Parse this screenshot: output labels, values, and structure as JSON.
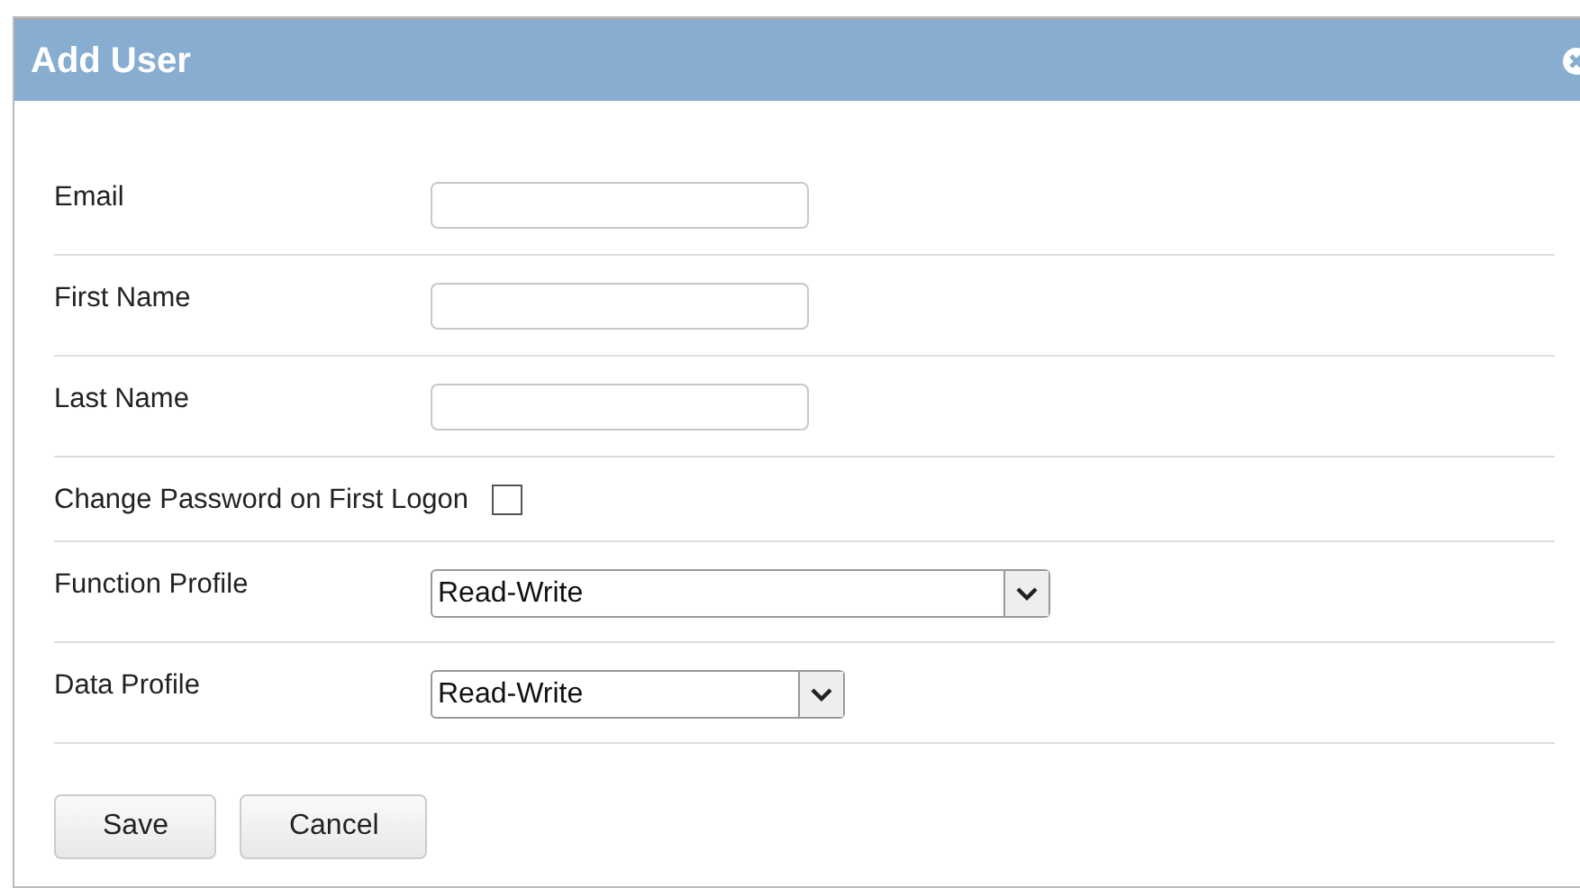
{
  "dialog": {
    "title": "Add User"
  },
  "fields": [
    {
      "kind": "text",
      "label": "Email"
    },
    {
      "kind": "text",
      "label": "First Name"
    },
    {
      "kind": "text",
      "label": "Last Name"
    },
    {
      "kind": "checkbox",
      "label": "Change Password on First Logon",
      "checked": false
    },
    {
      "kind": "select",
      "label": "Function Profile",
      "value": "Read-Write",
      "wide": true
    },
    {
      "kind": "select",
      "label": "Data Profile",
      "value": "Read-Write",
      "wide": false
    }
  ],
  "buttons": [
    "Save",
    "Cancel"
  ]
}
